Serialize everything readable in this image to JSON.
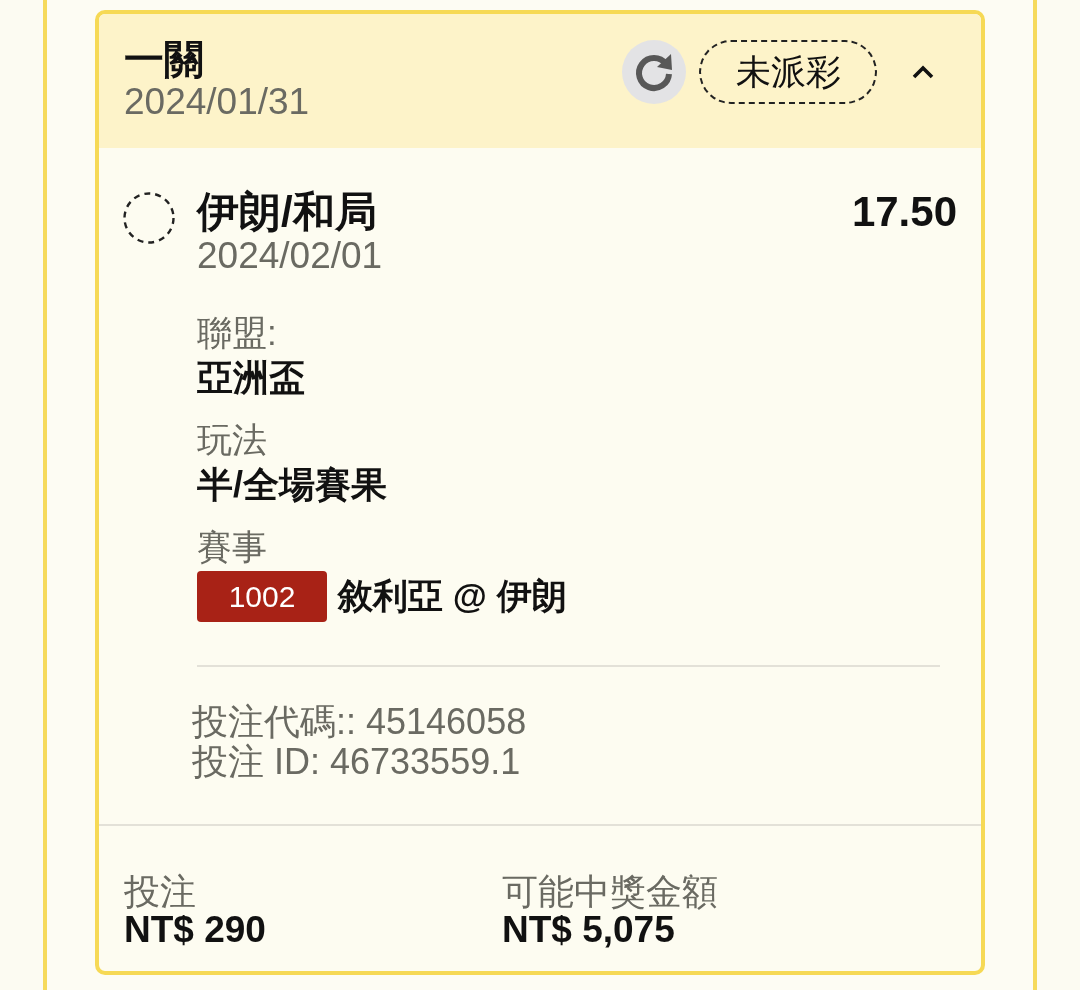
{
  "bet": {
    "title": "一關",
    "date": "2024/01/31",
    "status": "未派彩",
    "expanded": true
  },
  "selection": {
    "name": "伊朗/和局",
    "date": "2024/02/01",
    "odds": "17.50",
    "settled": false
  },
  "details": [
    {
      "label": "聯盟:",
      "value": "亞洲盃"
    },
    {
      "label": "玩法",
      "value": "半/全場賽果"
    },
    {
      "label": "賽事",
      "match_no": "1002",
      "value": "敘利亞 @ 伊朗"
    }
  ],
  "ids": [
    "投注代碼:: 45146058",
    "投注 ID: 46733559.1"
  ],
  "summary": [
    {
      "label": "投注",
      "value": "NT$ 290"
    },
    {
      "label": "可能中獎金額",
      "value": "NT$ 5,075"
    }
  ]
}
